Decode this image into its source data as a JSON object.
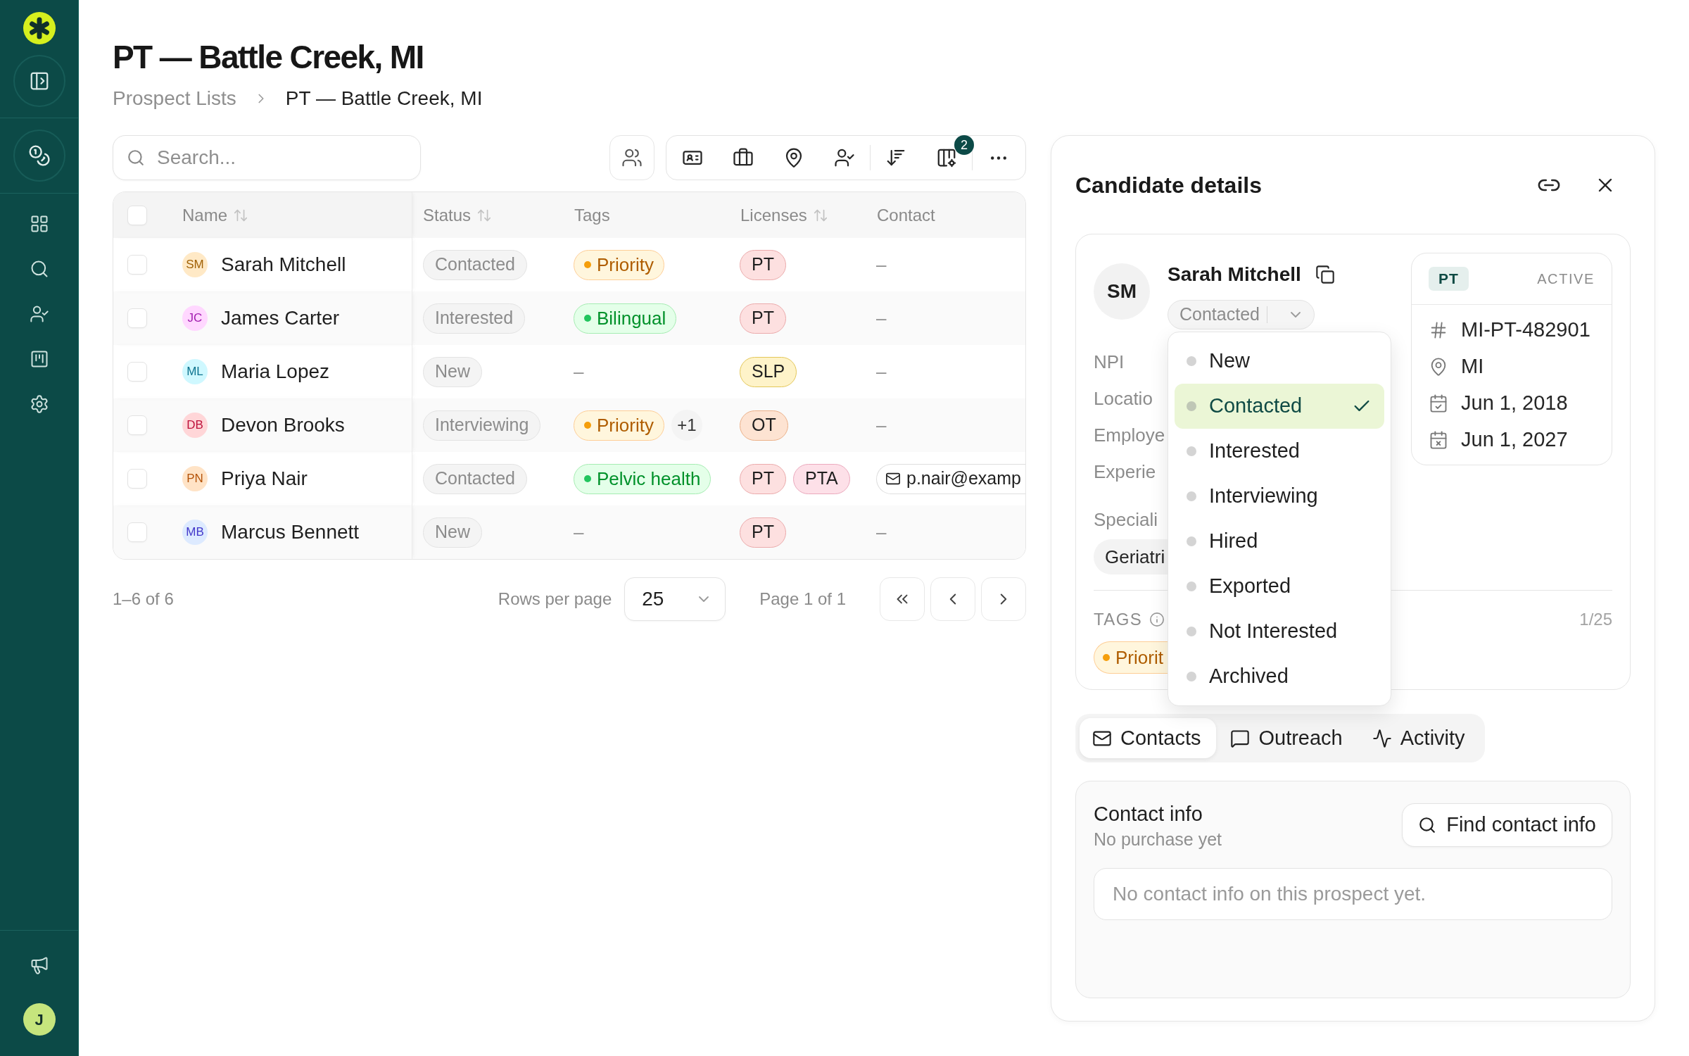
{
  "sidebar": {
    "user_initial": "J"
  },
  "header": {
    "title": "PT — Battle Creek, MI",
    "breadcrumb": [
      {
        "label": "Prospect Lists",
        "current": false
      },
      {
        "label": "PT — Battle Creek, MI",
        "current": true
      }
    ]
  },
  "search": {
    "placeholder": "Search..."
  },
  "toolbar": {
    "columns_badge": "2"
  },
  "table": {
    "select_all_checked": false,
    "columns": [
      {
        "label": "Name",
        "sortable": true
      },
      {
        "label": "Status",
        "sortable": true
      },
      {
        "label": "Tags",
        "sortable": false
      },
      {
        "label": "Licenses",
        "sortable": true
      },
      {
        "label": "Contact",
        "sortable": false
      }
    ],
    "rows": [
      {
        "checked": false,
        "initials": "SM",
        "color": "#a16207",
        "name": "Sarah Mitchell",
        "status": "Contacted",
        "tags": [
          {
            "kind": "tag",
            "label": "Priority",
            "color": "#f59e0b"
          }
        ],
        "licenses": [
          {
            "label": "PT",
            "color": "#fde0e0"
          }
        ],
        "contact": {
          "kind": "dash",
          "text": "–"
        }
      },
      {
        "checked": false,
        "initials": "JC",
        "color": "#a21caf",
        "name": "James Carter",
        "status": "Interested",
        "tags": [
          {
            "kind": "tag",
            "label": "Bilingual",
            "color": "#22c55e"
          }
        ],
        "licenses": [
          {
            "label": "PT",
            "color": "#fde0e0"
          }
        ],
        "contact": {
          "kind": "dash",
          "text": "–"
        }
      },
      {
        "checked": false,
        "initials": "ML",
        "color": "#0e7490",
        "name": "Maria Lopez",
        "status": "New",
        "tags": [
          {
            "kind": "dash",
            "label": "–"
          }
        ],
        "licenses": [
          {
            "label": "SLP",
            "color": "#fef3c9"
          }
        ],
        "contact": {
          "kind": "dash",
          "text": "–"
        }
      },
      {
        "checked": false,
        "initials": "DB",
        "color": "#be123c",
        "name": "Devon Brooks",
        "status": "Interviewing",
        "tags": [
          {
            "kind": "tag",
            "label": "Priority",
            "color": "#f59e0b"
          },
          {
            "kind": "more",
            "label": "+1"
          }
        ],
        "licenses": [
          {
            "label": "OT",
            "color": "#fde3d2"
          }
        ],
        "contact": {
          "kind": "dash",
          "text": "–"
        }
      },
      {
        "checked": false,
        "initials": "PN",
        "color": "#b45309",
        "name": "Priya Nair",
        "status": "Contacted",
        "tags": [
          {
            "kind": "tag",
            "label": "Pelvic health",
            "color": "#22c55e"
          }
        ],
        "licenses": [
          {
            "label": "PT",
            "color": "#fde0e0"
          },
          {
            "label": "PTA",
            "color": "#fde0e8"
          }
        ],
        "contact": {
          "kind": "email",
          "text": "p.nair@examp"
        }
      },
      {
        "checked": false,
        "initials": "MB",
        "color": "#4338ca",
        "name": "Marcus Bennett",
        "status": "New",
        "tags": [
          {
            "kind": "dash",
            "label": "–"
          }
        ],
        "licenses": [
          {
            "label": "PT",
            "color": "#fde0e0"
          }
        ],
        "contact": {
          "kind": "dash",
          "text": "–"
        }
      }
    ]
  },
  "pagination": {
    "range": "1–6 of 6",
    "rows_per_page_label": "Rows per page",
    "rows_per_page": "25",
    "page_label": "Page 1 of 1"
  },
  "details": {
    "title": "Candidate details",
    "candidate": {
      "initials": "SM",
      "name": "Sarah Mitchell",
      "status": "Contacted",
      "status_menu_open": true
    },
    "fields": [
      "NPI",
      "Locatio",
      "Employe",
      "Experie"
    ],
    "specialty": {
      "label": "Speciali",
      "chips": [
        "Geriatri"
      ]
    },
    "license": {
      "type": "PT",
      "state": "ACTIVE",
      "rows": [
        {
          "kind": "number",
          "text": "MI-PT-482901"
        },
        {
          "kind": "location",
          "text": "MI"
        },
        {
          "kind": "issued",
          "text": "Jun 1, 2018"
        },
        {
          "kind": "expires",
          "text": "Jun 1, 2027"
        }
      ]
    },
    "tags": {
      "label": "TAGS",
      "count": "1/25",
      "items": [
        {
          "label": "Priorit",
          "color": "#f59e0b"
        }
      ]
    },
    "status_menu": [
      {
        "label": "New",
        "selected": false
      },
      {
        "label": "Contacted",
        "selected": true
      },
      {
        "label": "Interested",
        "selected": false
      },
      {
        "label": "Interviewing",
        "selected": false
      },
      {
        "label": "Hired",
        "selected": false
      },
      {
        "label": "Exported",
        "selected": false
      },
      {
        "label": "Not Interested",
        "selected": false
      },
      {
        "label": "Archived",
        "selected": false
      }
    ],
    "tabs": [
      {
        "kind": "mail",
        "label": "Contacts",
        "selected": true
      },
      {
        "kind": "message",
        "label": "Outreach",
        "selected": false
      },
      {
        "kind": "activity",
        "label": "Activity",
        "selected": false
      }
    ],
    "contact_info": {
      "title": "Contact info",
      "subtitle": "No purchase yet",
      "button": "Find contact info",
      "empty_text": "No contact info on this prospect yet."
    }
  }
}
